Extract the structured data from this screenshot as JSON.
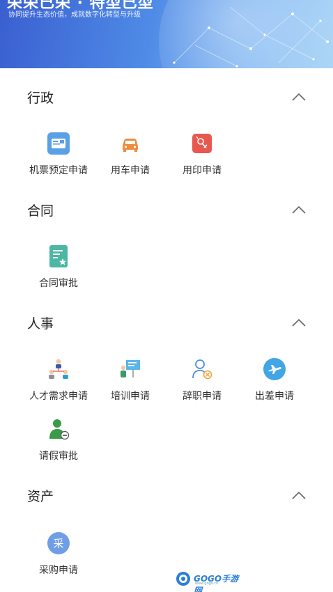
{
  "banner": {
    "title": "荣荣已荣 · 特型已型",
    "subtitle": "协同提升生态价值，成就数字化转型与升级"
  },
  "sections": [
    {
      "title": "行政",
      "items": [
        {
          "label": "机票预定申请",
          "icon": "flight-ticket-icon"
        },
        {
          "label": "用车申请",
          "icon": "car-icon"
        },
        {
          "label": "用印申请",
          "icon": "seal-icon"
        }
      ]
    },
    {
      "title": "合同",
      "items": [
        {
          "label": "合同审批",
          "icon": "contract-icon"
        }
      ]
    },
    {
      "title": "人事",
      "items": [
        {
          "label": "人才需求申请",
          "icon": "talent-icon"
        },
        {
          "label": "培训申请",
          "icon": "training-icon"
        },
        {
          "label": "辞职申请",
          "icon": "resign-icon"
        },
        {
          "label": "出差申请",
          "icon": "business-trip-icon"
        },
        {
          "label": "请假审批",
          "icon": "leave-icon"
        }
      ]
    },
    {
      "title": "资产",
      "items": [
        {
          "label": "采购申请",
          "icon": "purchase-icon",
          "glyph": "采"
        }
      ]
    }
  ],
  "watermark": {
    "text": "GOGO手游网",
    "sub": "www.gogo.cn"
  },
  "colors": {
    "flight": "#5aa0e8",
    "car": "#f08a3c",
    "seal": "#e8584f",
    "contract": "#4db6a4",
    "business_trip": "#42a5e6",
    "purchase": "#6f9ee8"
  }
}
